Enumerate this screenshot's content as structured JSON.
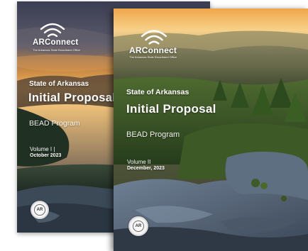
{
  "covers": [
    {
      "brand": "ARConnect",
      "tagline": "The Arkansas State Broadband Office",
      "state": "State of Arkansas",
      "title": "Initial Proposal",
      "program": "BEAD Program",
      "volume": "Volume I  |",
      "date": "October 2023",
      "logo_icon": "wifi-signal-icon",
      "seal_icon": "state-seal-icon"
    },
    {
      "brand": "ARConnect",
      "tagline": "The Arkansas State Broadband Office",
      "state": "State of Arkansas",
      "title": "Initial Proposal",
      "program": "BEAD Program",
      "volume": "Volume II",
      "date": "December, 2023",
      "logo_icon": "wifi-signal-icon",
      "seal_icon": "state-seal-icon"
    }
  ],
  "colors": {
    "sky_top": "#3d3f55",
    "sunset": "#e7a24c",
    "forest": "#2f4a24",
    "rock": "#4f5f73",
    "text": "#ffffff"
  }
}
